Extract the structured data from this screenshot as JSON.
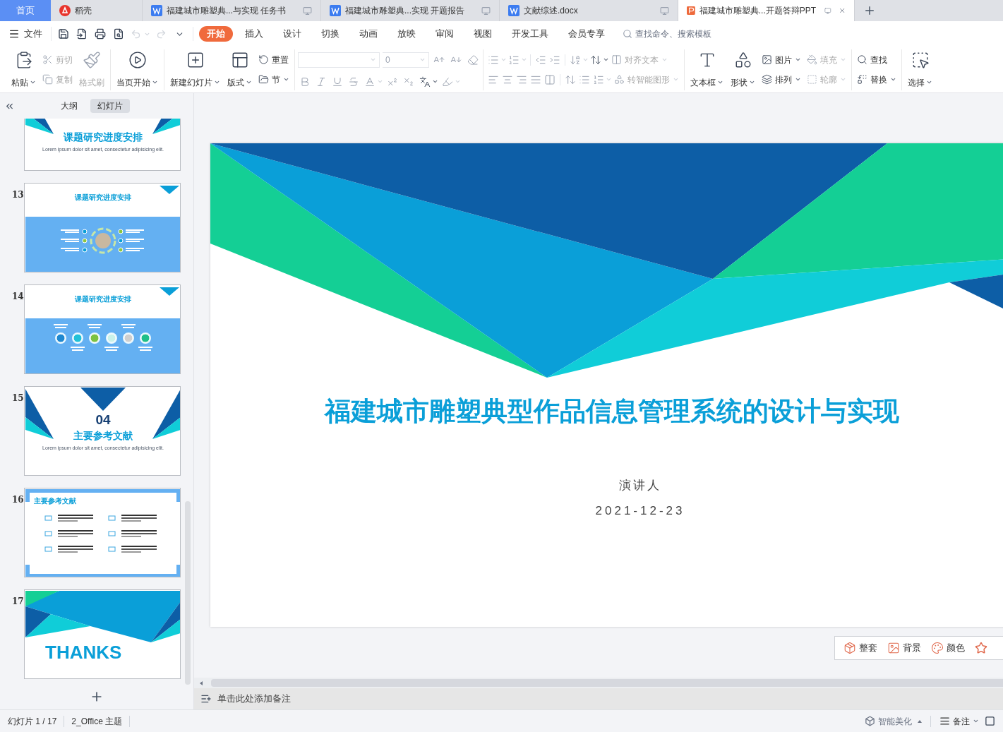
{
  "tabs": [
    {
      "label": "首页",
      "kind": "home",
      "selected": false
    },
    {
      "label": "稻壳",
      "kind": "app",
      "selected": false
    },
    {
      "label": "福建城市雕塑典...与实现 任务书",
      "kind": "doc",
      "selected": false
    },
    {
      "label": "福建城市雕塑典...实现 开题报告",
      "kind": "doc",
      "selected": false
    },
    {
      "label": "文献综述.docx",
      "kind": "doc",
      "selected": false
    },
    {
      "label": "福建城市雕塑典...开题答辩PPT",
      "kind": "ppt",
      "selected": true
    }
  ],
  "menu": {
    "file": "文件",
    "tabs": [
      {
        "label": "开始",
        "selected": true
      },
      {
        "label": "插入",
        "selected": false
      },
      {
        "label": "设计",
        "selected": false
      },
      {
        "label": "切换",
        "selected": false
      },
      {
        "label": "动画",
        "selected": false
      },
      {
        "label": "放映",
        "selected": false
      },
      {
        "label": "审阅",
        "selected": false
      },
      {
        "label": "视图",
        "selected": false
      },
      {
        "label": "开发工具",
        "selected": false
      },
      {
        "label": "会员专享",
        "selected": false
      }
    ],
    "search": {
      "placeholder": "查找命令、搜索模板"
    }
  },
  "ribbon": [
    {
      "kind": "buttons",
      "items": [
        {
          "label": "粘贴",
          "kind": "large",
          "dropdown": true,
          "disabled": false
        },
        {
          "label": "剪切",
          "kind": "small",
          "dropdown": false,
          "disabled": true
        },
        {
          "label": "复制",
          "kind": "small",
          "dropdown": false,
          "disabled": true
        },
        {
          "label": "格式刷",
          "kind": "large",
          "dropdown": false,
          "disabled": true
        }
      ]
    },
    {
      "kind": "buttons",
      "items": [
        {
          "label": "当页开始",
          "kind": "large",
          "dropdown": true,
          "disabled": false
        }
      ]
    },
    {
      "kind": "buttons",
      "items": [
        {
          "label": "新建幻灯片",
          "kind": "large",
          "dropdown": true,
          "disabled": false
        },
        {
          "label": "版式",
          "kind": "large",
          "dropdown": true,
          "disabled": false
        },
        {
          "label": "重置",
          "kind": "small",
          "dropdown": false,
          "disabled": false
        },
        {
          "label": "节",
          "kind": "small",
          "dropdown": true,
          "disabled": false
        }
      ]
    },
    {
      "kind": "font",
      "size": "0"
    },
    {
      "kind": "paragraph",
      "items": [
        {
          "label": "对齐文本",
          "kind": "small",
          "dropdown": true,
          "disabled": true
        },
        {
          "label": "转智能图形",
          "kind": "small",
          "dropdown": true,
          "disabled": true
        }
      ]
    },
    {
      "kind": "buttons",
      "items": [
        {
          "label": "文本框",
          "kind": "large",
          "dropdown": true,
          "disabled": false
        },
        {
          "label": "形状",
          "kind": "large",
          "dropdown": true,
          "disabled": false
        },
        {
          "label": "图片",
          "kind": "small",
          "dropdown": true,
          "disabled": false
        },
        {
          "label": "排列",
          "kind": "small",
          "dropdown": true,
          "disabled": false
        },
        {
          "label": "填充",
          "kind": "small",
          "dropdown": true,
          "disabled": true
        },
        {
          "label": "轮廓",
          "kind": "small",
          "dropdown": true,
          "disabled": true
        }
      ]
    },
    {
      "kind": "buttons",
      "items": [
        {
          "label": "查找",
          "kind": "small",
          "dropdown": false,
          "disabled": false
        },
        {
          "label": "替换",
          "kind": "small",
          "dropdown": true,
          "disabled": false
        }
      ]
    },
    {
      "kind": "buttons",
      "items": [
        {
          "label": "选择",
          "kind": "large",
          "dropdown": true,
          "disabled": false
        }
      ]
    }
  ],
  "panel": {
    "tabs": [
      {
        "label": "大纲",
        "selected": false
      },
      {
        "label": "幻灯片",
        "selected": true
      }
    ],
    "slides": [
      {
        "kind": "section",
        "title": "课题研究进度安排",
        "subtitle": "Lorem ipsum dolor sit amet, consectetur adipisicing elit."
      },
      {
        "number": "13",
        "kind": "circle",
        "title": "课题研究进度安排"
      },
      {
        "number": "14",
        "kind": "steps",
        "title": "课题研究进度安排"
      },
      {
        "number": "15",
        "kind": "section",
        "index": "04",
        "title": "主要参考文献",
        "subtitle": "Lorem ipsum dolor sit amet, consectetur adipisicing elit."
      },
      {
        "number": "16",
        "kind": "references",
        "title": "主要参考文献"
      },
      {
        "number": "17",
        "kind": "thanks",
        "title": "THANKS"
      }
    ]
  },
  "slide": {
    "title": "福建城市雕塑典型作品信息管理系统的设计与实现",
    "speaker": "演讲人",
    "date": "2021-12-23"
  },
  "float_bar": [
    "整套",
    "背景",
    "颜色"
  ],
  "notes": {
    "placeholder": "单击此处添加备注"
  },
  "status_bar": {
    "left": [
      "幻灯片 1 / 17",
      "2_Office 主题"
    ],
    "smart": "智能美化",
    "notes": "备注"
  }
}
